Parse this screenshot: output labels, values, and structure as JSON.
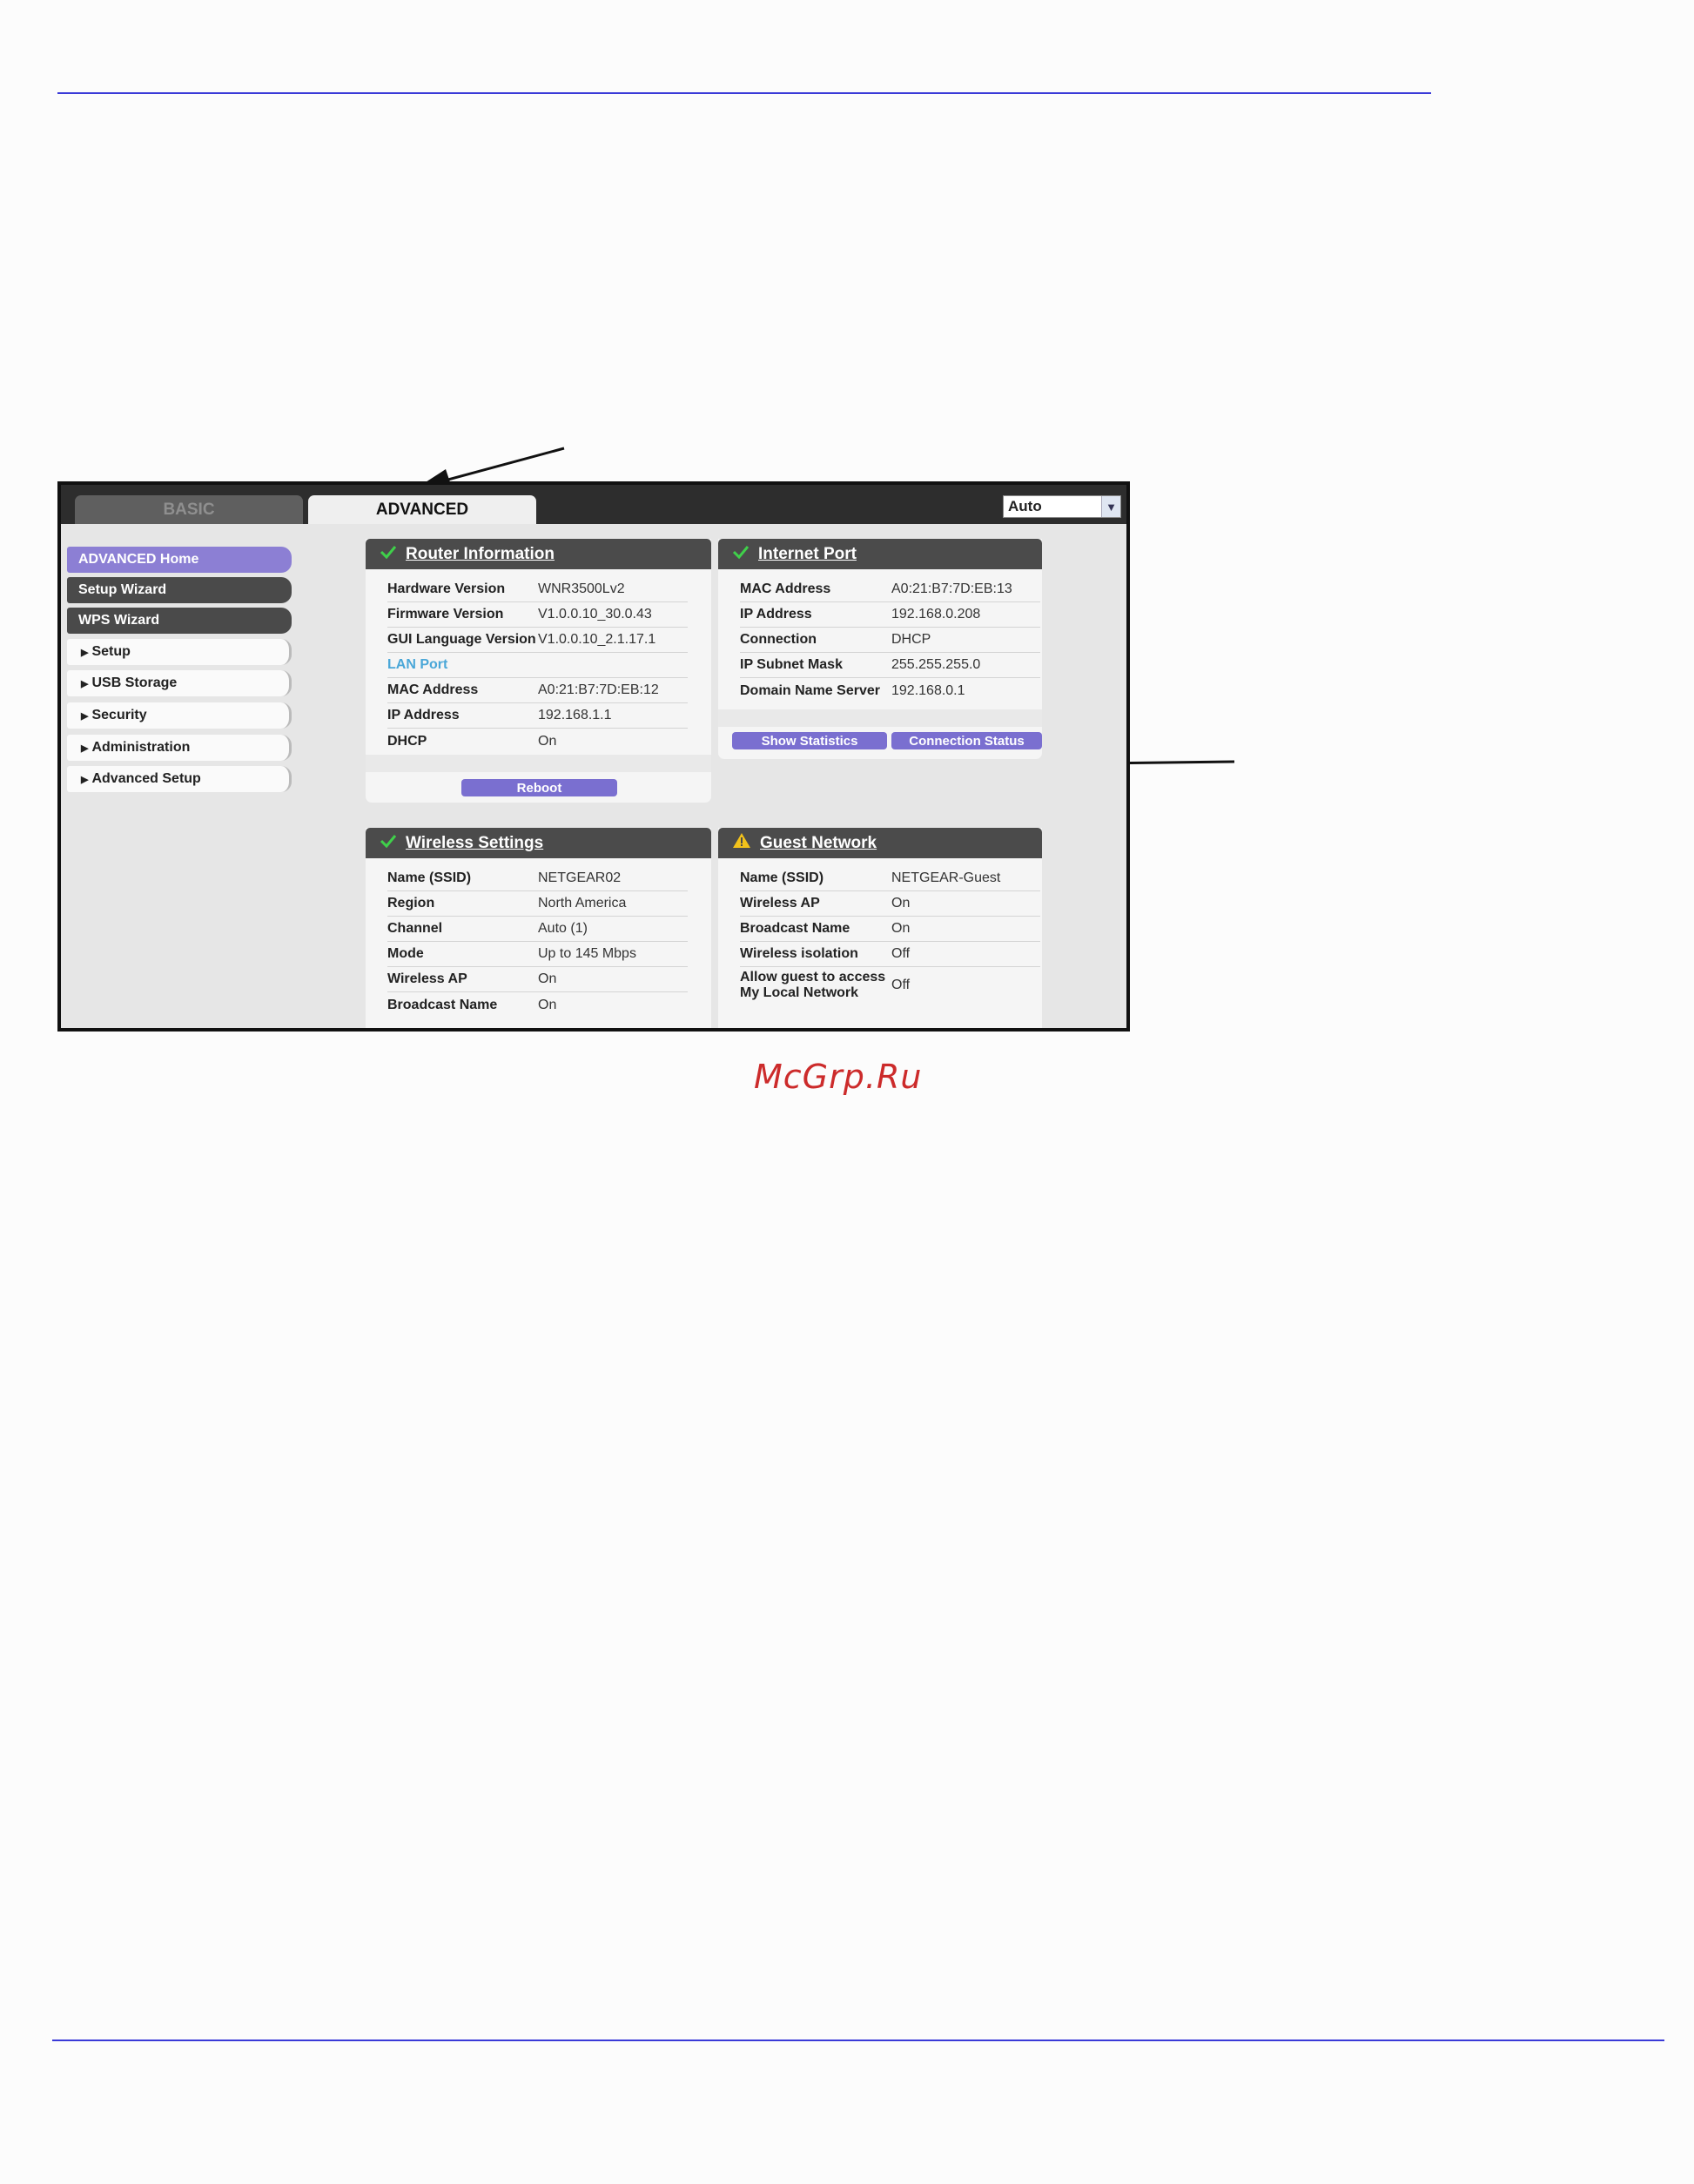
{
  "router_ui": {
    "tabs": {
      "basic": "BASIC",
      "advanced": "ADVANCED"
    },
    "language_select": {
      "value": "Auto"
    },
    "sidebar": {
      "items": [
        {
          "label": "ADVANCED Home"
        },
        {
          "label": "Setup Wizard"
        },
        {
          "label": "WPS Wizard"
        },
        {
          "label": "Setup"
        },
        {
          "label": "USB Storage"
        },
        {
          "label": "Security"
        },
        {
          "label": "Administration"
        },
        {
          "label": "Advanced Setup"
        }
      ]
    },
    "router_information": {
      "title": "Router Information",
      "rows": [
        {
          "label": "Hardware Version",
          "value": "WNR3500Lv2"
        },
        {
          "label": "Firmware Version",
          "value": "V1.0.0.10_30.0.43"
        },
        {
          "label": "GUI Language Version",
          "value": "V1.0.0.10_2.1.17.1"
        },
        {
          "label": "LAN Port",
          "value": ""
        },
        {
          "label": "MAC Address",
          "value": "A0:21:B7:7D:EB:12"
        },
        {
          "label": "IP Address",
          "value": "192.168.1.1"
        },
        {
          "label": "DHCP",
          "value": "On"
        }
      ],
      "reboot_label": "Reboot"
    },
    "internet_port": {
      "title": "Internet Port",
      "rows": [
        {
          "label": "MAC Address",
          "value": "A0:21:B7:7D:EB:13"
        },
        {
          "label": "IP Address",
          "value": "192.168.0.208"
        },
        {
          "label": "Connection",
          "value": "DHCP"
        },
        {
          "label": "IP Subnet Mask",
          "value": "255.255.255.0"
        },
        {
          "label": "Domain Name Server",
          "value": "192.168.0.1"
        }
      ],
      "show_statistics_label": "Show Statistics",
      "connection_status_label": "Connection Status"
    },
    "wireless_settings": {
      "title": "Wireless Settings",
      "rows": [
        {
          "label": "Name (SSID)",
          "value": "NETGEAR02"
        },
        {
          "label": "Region",
          "value": "North America"
        },
        {
          "label": "Channel",
          "value": "Auto (1)"
        },
        {
          "label": "Mode",
          "value": "Up to 145 Mbps"
        },
        {
          "label": "Wireless AP",
          "value": "On"
        },
        {
          "label": "Broadcast Name",
          "value": "On"
        }
      ]
    },
    "guest_network": {
      "title": "Guest Network",
      "rows": [
        {
          "label": "Name (SSID)",
          "value": "NETGEAR-Guest"
        },
        {
          "label": "Wireless AP",
          "value": "On"
        },
        {
          "label": "Broadcast Name",
          "value": "On"
        },
        {
          "label": "Wireless isolation",
          "value": "Off"
        },
        {
          "label": "Allow guest to access My Local Network",
          "value": "Off"
        }
      ]
    }
  },
  "watermark": "McGrp.Ru",
  "colors": {
    "rule": "#3a3ad8",
    "accent": "#7a6fd0",
    "watermark": "#cc2b2b"
  }
}
